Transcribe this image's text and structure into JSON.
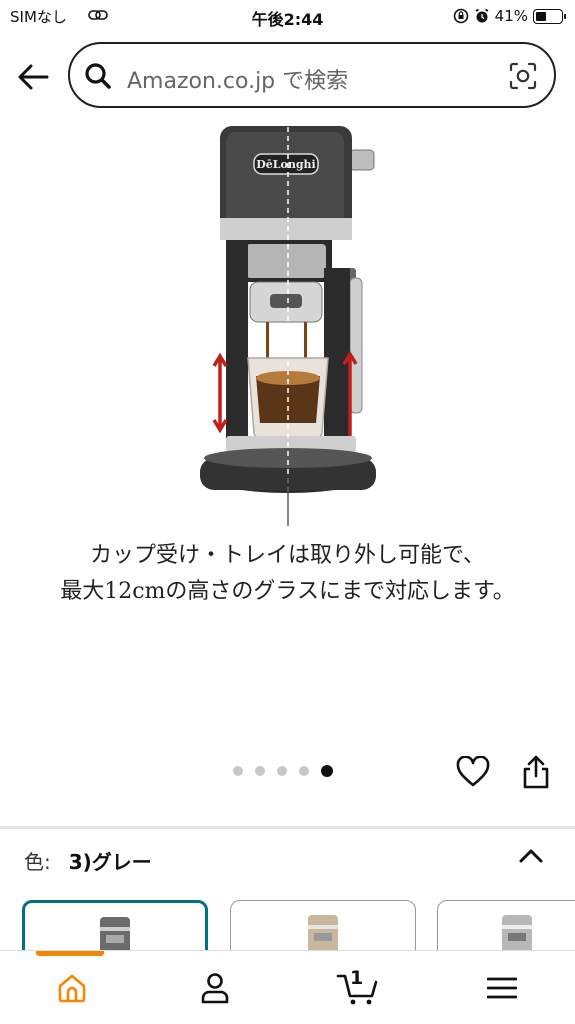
{
  "status_bar": {
    "carrier": "SIMなし",
    "time": "午後2:44",
    "battery": "41%"
  },
  "search": {
    "placeholder": "Amazon.co.jp で検索"
  },
  "product_image": {
    "brand_logo_text": "DēLonghi",
    "caption_line1": "カップ受け・トレイは取り外し可能で、",
    "caption_line2": "最大12cmの高さのグラスにまで対応します。",
    "page_count": 5,
    "active_page": 5
  },
  "variation": {
    "label": "色:",
    "selected_value": "3)グレー",
    "swatches": [
      {
        "name": "grey",
        "color": "#6b6b6b"
      },
      {
        "name": "beige",
        "color": "#c9b79c"
      },
      {
        "name": "silver",
        "color": "#b8b8b8"
      }
    ]
  },
  "bottom_nav": {
    "cart_count": "1",
    "accent_color": "#f08804"
  },
  "colors": {
    "selected_swatch_border": "#007185",
    "home_icon": "#f08804"
  }
}
